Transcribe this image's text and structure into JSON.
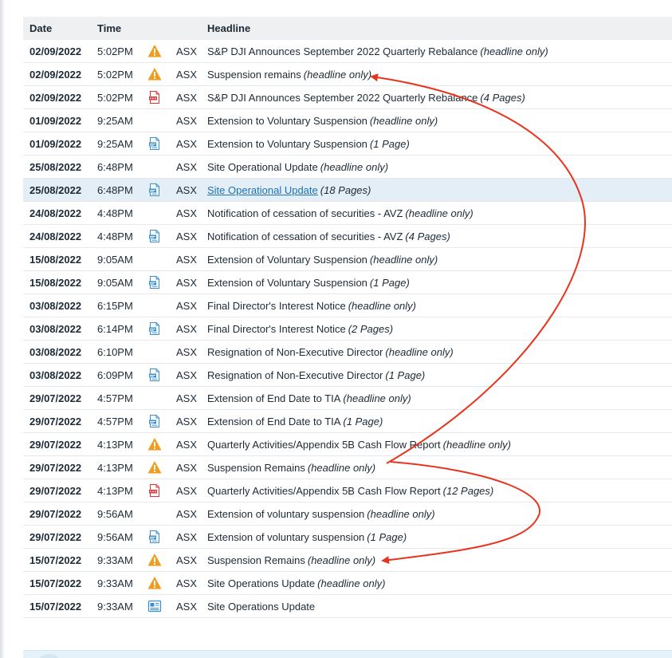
{
  "table": {
    "headers": {
      "date": "Date",
      "time": "Time",
      "headline": "Headline"
    },
    "rows": [
      {
        "date": "02/09/2022",
        "time": "5:02PM",
        "icon": "warning-icon",
        "exch": "ASX",
        "headline": "S&P DJI Announces September 2022 Quarterly Rebalance",
        "note": "(headline only)"
      },
      {
        "date": "02/09/2022",
        "time": "5:02PM",
        "icon": "warning-icon",
        "exch": "ASX",
        "headline": "Suspension remains",
        "note": "(headline only)"
      },
      {
        "date": "02/09/2022",
        "time": "5:02PM",
        "icon": "pdf-icon",
        "exch": "ASX",
        "headline": "S&P DJI Announces September 2022 Quarterly Rebalance",
        "note": "(4 Pages)"
      },
      {
        "date": "01/09/2022",
        "time": "9:25AM",
        "icon": "",
        "exch": "ASX",
        "headline": "Extension to Voluntary Suspension",
        "note": "(headline only)"
      },
      {
        "date": "01/09/2022",
        "time": "9:25AM",
        "icon": "document-icon",
        "exch": "ASX",
        "headline": "Extension to Voluntary Suspension",
        "note": "(1 Page)"
      },
      {
        "date": "25/08/2022",
        "time": "6:48PM",
        "icon": "",
        "exch": "ASX",
        "headline": "Site Operational Update",
        "note": "(headline only)"
      },
      {
        "date": "25/08/2022",
        "time": "6:48PM",
        "icon": "document-icon",
        "exch": "ASX",
        "headline": "Site Operational Update",
        "note": "(18 Pages)",
        "link": true,
        "highlight": true
      },
      {
        "date": "24/08/2022",
        "time": "4:48PM",
        "icon": "",
        "exch": "ASX",
        "headline": "Notification of cessation of securities - AVZ",
        "note": "(headline only)"
      },
      {
        "date": "24/08/2022",
        "time": "4:48PM",
        "icon": "document-icon",
        "exch": "ASX",
        "headline": "Notification of cessation of securities - AVZ",
        "note": "(4 Pages)"
      },
      {
        "date": "15/08/2022",
        "time": "9:05AM",
        "icon": "",
        "exch": "ASX",
        "headline": "Extension of Voluntary Suspension",
        "note": "(headline only)"
      },
      {
        "date": "15/08/2022",
        "time": "9:05AM",
        "icon": "document-icon",
        "exch": "ASX",
        "headline": "Extension of Voluntary Suspension",
        "note": "(1 Page)"
      },
      {
        "date": "03/08/2022",
        "time": "6:15PM",
        "icon": "",
        "exch": "ASX",
        "headline": "Final Director's Interest Notice",
        "note": "(headline only)"
      },
      {
        "date": "03/08/2022",
        "time": "6:14PM",
        "icon": "document-icon",
        "exch": "ASX",
        "headline": "Final Director's Interest Notice",
        "note": "(2 Pages)"
      },
      {
        "date": "03/08/2022",
        "time": "6:10PM",
        "icon": "",
        "exch": "ASX",
        "headline": "Resignation of Non-Executive Director",
        "note": "(headline only)"
      },
      {
        "date": "03/08/2022",
        "time": "6:09PM",
        "icon": "document-icon",
        "exch": "ASX",
        "headline": "Resignation of Non-Executive Director",
        "note": "(1 Page)"
      },
      {
        "date": "29/07/2022",
        "time": "4:57PM",
        "icon": "",
        "exch": "ASX",
        "headline": "Extension of End Date to TIA",
        "note": "(headline only)"
      },
      {
        "date": "29/07/2022",
        "time": "4:57PM",
        "icon": "document-icon",
        "exch": "ASX",
        "headline": "Extension of End Date to TIA",
        "note": "(1 Page)"
      },
      {
        "date": "29/07/2022",
        "time": "4:13PM",
        "icon": "warning-icon",
        "exch": "ASX",
        "headline": "Quarterly Activities/Appendix 5B Cash Flow Report",
        "note": "(headline only)"
      },
      {
        "date": "29/07/2022",
        "time": "4:13PM",
        "icon": "warning-icon",
        "exch": "ASX",
        "headline": "Suspension Remains",
        "note": "(headline only)"
      },
      {
        "date": "29/07/2022",
        "time": "4:13PM",
        "icon": "pdf-icon",
        "exch": "ASX",
        "headline": "Quarterly Activities/Appendix 5B Cash Flow Report",
        "note": "(12 Pages)"
      },
      {
        "date": "29/07/2022",
        "time": "9:56AM",
        "icon": "",
        "exch": "ASX",
        "headline": "Extension of voluntary suspension",
        "note": "(headline only)"
      },
      {
        "date": "29/07/2022",
        "time": "9:56AM",
        "icon": "document-icon",
        "exch": "ASX",
        "headline": "Extension of voluntary suspension",
        "note": "(1 Page)"
      },
      {
        "date": "15/07/2022",
        "time": "9:33AM",
        "icon": "warning-icon",
        "exch": "ASX",
        "headline": "Suspension Remains",
        "note": "(headline only)"
      },
      {
        "date": "15/07/2022",
        "time": "9:33AM",
        "icon": "warning-icon",
        "exch": "ASX",
        "headline": "Site Operations Update",
        "note": "(headline only)"
      },
      {
        "date": "15/07/2022",
        "time": "9:33AM",
        "icon": "newspaper-icon",
        "exch": "ASX",
        "headline": "Site Operations Update",
        "note": ""
      }
    ]
  },
  "colors": {
    "warning": "#f29b1d",
    "pdf": "#d9353a",
    "document": "#3a8fd0",
    "link": "#1b73b3",
    "annotation_arrow": "#e8341f"
  }
}
